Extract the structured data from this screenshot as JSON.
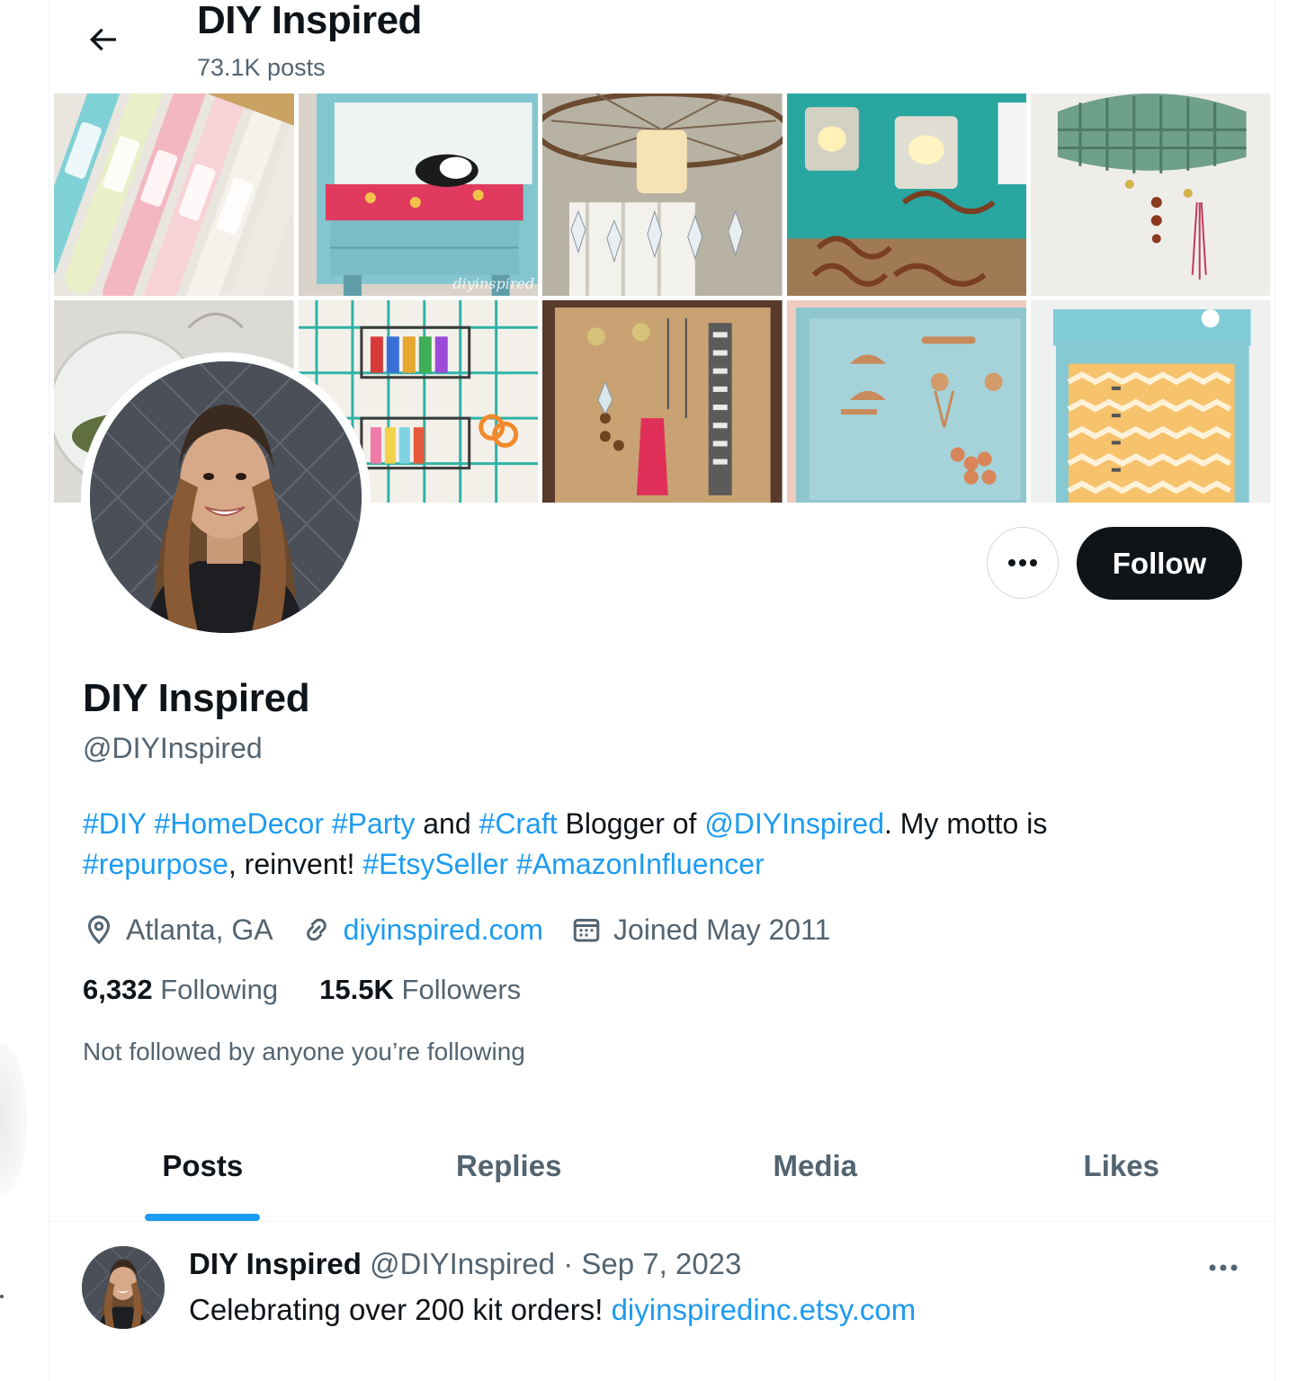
{
  "header": {
    "title": "DIY Inspired",
    "post_count": "73.1K posts"
  },
  "banner": {
    "watermark": "diyinspired",
    "tiles": [
      "glitter-tubes-photo",
      "painted-nightstand-photo",
      "wheel-chandelier-photo",
      "spring-candle-holders-photo",
      "basket-jewelry-holder-photo",
      "glass-terrarium-photo",
      "wire-grid-organizer-photo",
      "cork-earring-board-photo",
      "drawer-pull-jewelry-board-photo",
      "chevron-dresser-photo"
    ]
  },
  "profile": {
    "display_name": "DIY Inspired",
    "handle": "@DIYInspired",
    "follow_label": "Follow",
    "bio": {
      "diy": "#DIY",
      "homedecor": "#HomeDecor",
      "party": "#Party",
      "and": "and",
      "craft": "#Craft",
      "blogger_of": "Blogger of",
      "mention": "@DIYInspired",
      "motto": ". My motto is",
      "repurpose": "#repurpose",
      "reinvent": ", reinvent!",
      "etsyseller": "#EtsySeller",
      "amazoninfluencer": "#AmazonInfluencer"
    },
    "location": "Atlanta, GA",
    "website": "diyinspired.com",
    "joined": "Joined May 2011",
    "following_count": "6,332",
    "following_label": "Following",
    "followers_count": "15.5K",
    "followers_label": "Followers",
    "not_followed": "Not followed by anyone you’re following"
  },
  "tabs": [
    {
      "label": "Posts",
      "active": true
    },
    {
      "label": "Replies",
      "active": false
    },
    {
      "label": "Media",
      "active": false
    },
    {
      "label": "Likes",
      "active": false
    }
  ],
  "post": {
    "author": "DIY Inspired",
    "handle": "@DIYInspired",
    "separator": "·",
    "date": "Sep 7, 2023",
    "text": "Celebrating over 200 kit orders!",
    "link": "diyinspiredinc.etsy.com"
  },
  "colors": {
    "accent": "#1d9bf0",
    "text_primary": "#0f1419",
    "text_secondary": "#536471",
    "follow_button": "#0f1419"
  }
}
